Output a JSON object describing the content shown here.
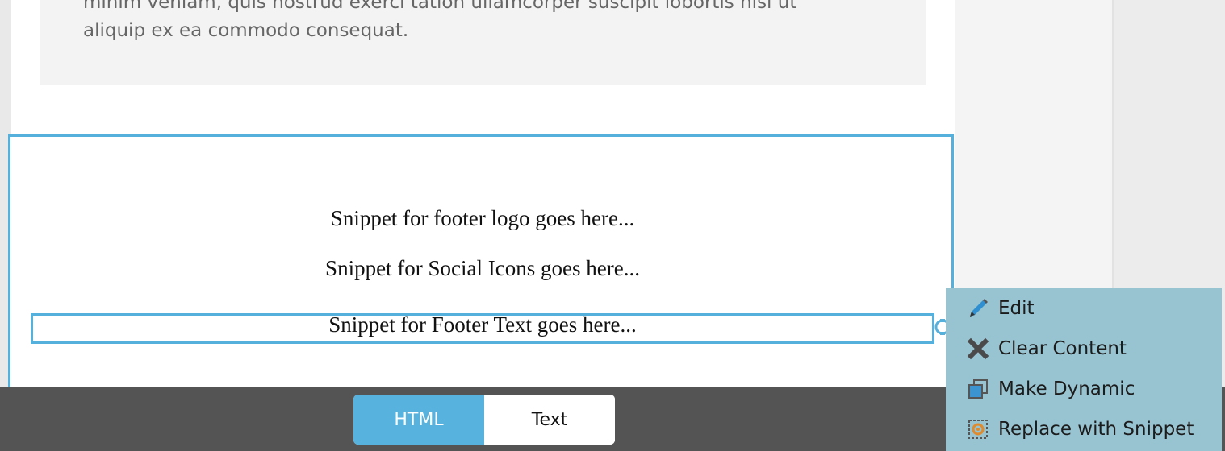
{
  "content": {
    "body_text_line1": "minim veniam, quis nostrud exerci tation ullamcorper suscipit lobortis nisl ut",
    "body_text_line2": "aliquip ex ea commodo consequat."
  },
  "footer": {
    "logo_snippet": "Snippet for footer logo goes here...",
    "social_snippet": "Snippet for Social Icons goes here...",
    "text_snippet": "Snippet for Footer Text goes here..."
  },
  "context_menu": {
    "items": [
      {
        "label": "Edit",
        "icon": "pencil-icon"
      },
      {
        "label": "Clear Content",
        "icon": "close-icon"
      },
      {
        "label": "Make Dynamic",
        "icon": "layers-icon"
      },
      {
        "label": "Replace with Snippet",
        "icon": "snippet-icon"
      }
    ]
  },
  "view_toggle": {
    "html_label": "HTML",
    "text_label": "Text",
    "active": "HTML"
  },
  "colors": {
    "selection_border": "#56b0dc",
    "active_toggle": "#57b2de",
    "menu_background": "#98c4d2",
    "bottom_bar": "#545454"
  }
}
